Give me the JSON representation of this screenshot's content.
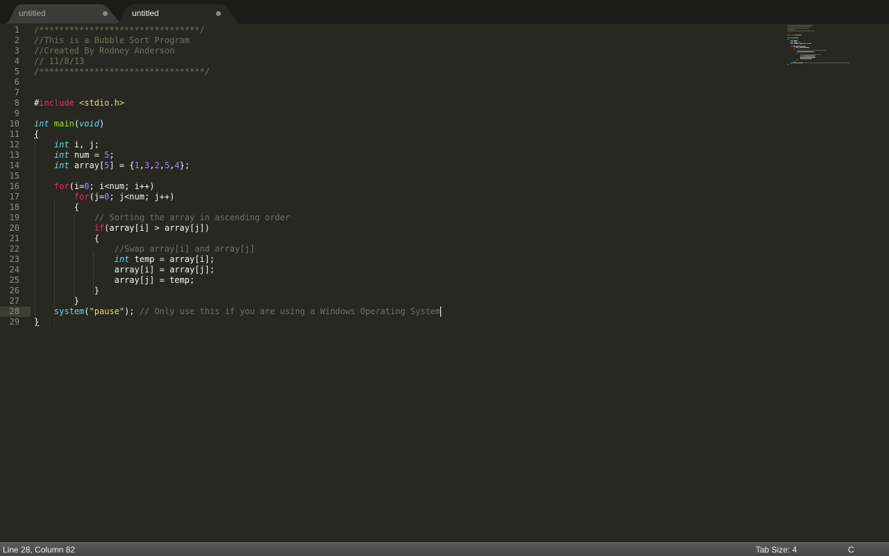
{
  "tabs": [
    {
      "label": "untitled",
      "active": false,
      "dirty": true
    },
    {
      "label": "untitled",
      "active": true,
      "dirty": true
    }
  ],
  "editor": {
    "active_line": 28,
    "lines": [
      {
        "n": "1",
        "segs": [
          [
            "c",
            "/********************************/"
          ]
        ]
      },
      {
        "n": "2",
        "segs": [
          [
            "c",
            "//This is a Bubble Sort Program"
          ]
        ]
      },
      {
        "n": "3",
        "segs": [
          [
            "c",
            "//Created By Rodney Anderson"
          ]
        ]
      },
      {
        "n": "4",
        "segs": [
          [
            "c",
            "// 11/8/13"
          ]
        ]
      },
      {
        "n": "5",
        "segs": [
          [
            "c",
            "/*********************************/"
          ]
        ]
      },
      {
        "n": "6",
        "segs": []
      },
      {
        "n": "7",
        "segs": []
      },
      {
        "n": "8",
        "segs": [
          [
            "p",
            "#"
          ],
          [
            "k",
            "include"
          ],
          [
            "p",
            " "
          ],
          [
            "s",
            "<stdio.h>"
          ]
        ]
      },
      {
        "n": "9",
        "segs": []
      },
      {
        "n": "10",
        "segs": [
          [
            "t",
            "int"
          ],
          [
            "p",
            " "
          ],
          [
            "f",
            "main"
          ],
          [
            "p",
            "("
          ],
          [
            "t",
            "void"
          ],
          [
            "p",
            ")"
          ]
        ]
      },
      {
        "n": "11",
        "segs": [
          [
            "u",
            "{"
          ]
        ]
      },
      {
        "n": "12",
        "segs": [
          [
            "p",
            "    "
          ],
          [
            "t",
            "int"
          ],
          [
            "p",
            " i, j;"
          ]
        ]
      },
      {
        "n": "13",
        "segs": [
          [
            "p",
            "    "
          ],
          [
            "t",
            "int"
          ],
          [
            "p",
            " num = "
          ],
          [
            "n",
            "5"
          ],
          [
            "p",
            ";"
          ]
        ]
      },
      {
        "n": "14",
        "segs": [
          [
            "p",
            "    "
          ],
          [
            "t",
            "int"
          ],
          [
            "p",
            " array["
          ],
          [
            "n",
            "5"
          ],
          [
            "p",
            "] = {"
          ],
          [
            "n",
            "1"
          ],
          [
            "p",
            ","
          ],
          [
            "n",
            "3"
          ],
          [
            "p",
            ","
          ],
          [
            "n",
            "2"
          ],
          [
            "p",
            ","
          ],
          [
            "n",
            "5"
          ],
          [
            "p",
            ","
          ],
          [
            "n",
            "4"
          ],
          [
            "p",
            "};"
          ]
        ]
      },
      {
        "n": "15",
        "segs": []
      },
      {
        "n": "16",
        "segs": [
          [
            "p",
            "    "
          ],
          [
            "k",
            "for"
          ],
          [
            "p",
            "(i="
          ],
          [
            "n",
            "0"
          ],
          [
            "p",
            "; i<num; i++)"
          ]
        ]
      },
      {
        "n": "17",
        "segs": [
          [
            "p",
            "        "
          ],
          [
            "k",
            "for"
          ],
          [
            "p",
            "(j="
          ],
          [
            "n",
            "0"
          ],
          [
            "p",
            "; j<num; j++)"
          ]
        ]
      },
      {
        "n": "18",
        "segs": [
          [
            "p",
            "        {"
          ]
        ]
      },
      {
        "n": "19",
        "segs": [
          [
            "p",
            "            "
          ],
          [
            "c",
            "// Sorting the array in ascending order"
          ]
        ]
      },
      {
        "n": "20",
        "segs": [
          [
            "p",
            "            "
          ],
          [
            "k",
            "if"
          ],
          [
            "p",
            "(array[i] > array[j])"
          ]
        ]
      },
      {
        "n": "21",
        "segs": [
          [
            "p",
            "            {"
          ]
        ]
      },
      {
        "n": "22",
        "segs": [
          [
            "p",
            "                "
          ],
          [
            "c",
            "//Swap array[i] and array[j]"
          ]
        ]
      },
      {
        "n": "23",
        "segs": [
          [
            "p",
            "                "
          ],
          [
            "t",
            "int"
          ],
          [
            "p",
            " temp = array[i];"
          ]
        ]
      },
      {
        "n": "24",
        "segs": [
          [
            "p",
            "                array[i] = array[j];"
          ]
        ]
      },
      {
        "n": "25",
        "segs": [
          [
            "p",
            "                array[j] = temp;"
          ]
        ]
      },
      {
        "n": "26",
        "segs": [
          [
            "p",
            "            }"
          ]
        ]
      },
      {
        "n": "27",
        "segs": [
          [
            "p",
            "        }"
          ]
        ]
      },
      {
        "n": "28",
        "segs": [
          [
            "p",
            "    "
          ],
          [
            "b",
            "system"
          ],
          [
            "p",
            "("
          ],
          [
            "s",
            "\"pause\""
          ],
          [
            "p",
            "); "
          ],
          [
            "c",
            "// Only use this if you are using a Windows Operating System"
          ]
        ]
      },
      {
        "n": "29",
        "segs": [
          [
            "u",
            "}"
          ]
        ]
      }
    ]
  },
  "status": {
    "position": "Line 28, Column 82",
    "tab_size": "Tab Size: 4",
    "syntax": "C"
  },
  "colors": {
    "background": "#272822",
    "comment": "#75715e",
    "keyword": "#f92672",
    "type": "#66d9ef",
    "function": "#a6e22e",
    "number": "#ae81ff",
    "string": "#e6db74"
  }
}
